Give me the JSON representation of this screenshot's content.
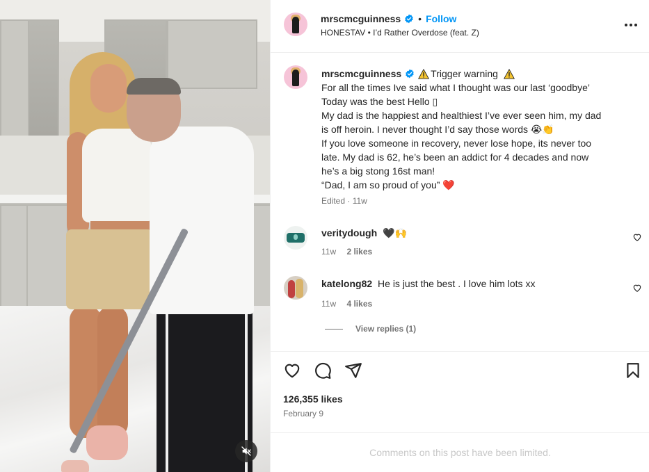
{
  "header": {
    "username": "mrscmcguinness",
    "separator": "•",
    "follow_label": "Follow",
    "audio_artist": "HONESTAV",
    "audio_separator": "•",
    "audio_track": "I’d Rather Overdose (feat. Z)"
  },
  "caption": {
    "username": "mrscmcguinness",
    "line1_text": "Trigger warning",
    "lines": [
      "For all the times Ive said what I thought was our last ‘goodbye’",
      "Today was the best Hello ▯",
      "My dad is the happiest and healthiest I’ve ever seen him, my dad",
      "is off heroin. I never thought I’d say those words 😭👏",
      "If you love someone in recovery, never lose hope, its never too",
      "late. My dad is 62, he’s been an addict for 4 decades and now",
      "he’s a big stong 16st man!",
      "“Dad, I am so proud of you” ❤️"
    ],
    "edited": "Edited",
    "meta_separator": "·",
    "time": "11w"
  },
  "comments": [
    {
      "username": "veritydough",
      "text": "🖤🙌",
      "time": "11w",
      "likes": "2 likes"
    },
    {
      "username": "katelong82",
      "text": "He is just the best . I love him lots xx",
      "time": "11w",
      "likes": "4 likes"
    }
  ],
  "view_replies": "View replies (1)",
  "likes_count": "126,355 likes",
  "post_date": "February 9",
  "comments_limited": "Comments on this post have been limited.",
  "colors": {
    "link_blue": "#0095f6",
    "text": "#262626",
    "secondary": "#737373",
    "divider": "#efefef",
    "heart_red": "#e0245e"
  },
  "icons": {
    "more": "more-options-icon",
    "verified": "verified-badge-icon",
    "warning": "warning-icon",
    "like": "heart-icon",
    "comment": "comment-icon",
    "share": "share-icon",
    "save": "bookmark-icon",
    "mute": "muted-speaker-icon"
  }
}
